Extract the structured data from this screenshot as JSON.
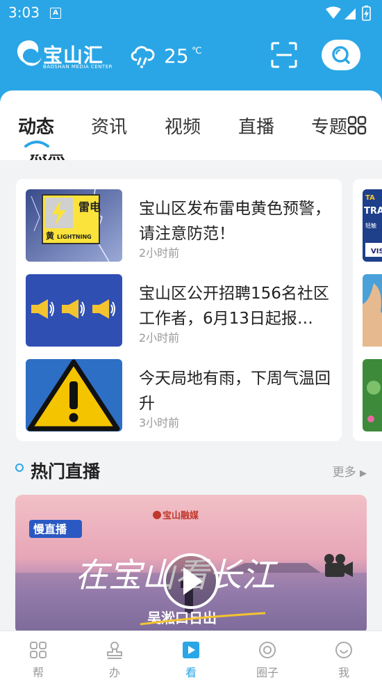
{
  "status_bar": {
    "time": "3:03",
    "notification_letter": "A"
  },
  "header": {
    "logo_text": "宝山汇",
    "logo_sub": "BAOSHAN MEDIA CENTER",
    "temperature": "25",
    "temperature_unit": "℃",
    "weather_icon": "rain-cloud-icon",
    "accent_color": "#2aa6e6"
  },
  "tabs": [
    {
      "label": "动态",
      "active": true
    },
    {
      "label": "资讯",
      "active": false
    },
    {
      "label": "视频",
      "active": false
    },
    {
      "label": "直播",
      "active": false
    },
    {
      "label": "专题",
      "active": false
    }
  ],
  "news": [
    {
      "title": "宝山区发布雷电黄色预警，请注意防范！",
      "time": "2小时前",
      "thumb": "lightning-warning-image",
      "thumb_text": {
        "top": "雷电",
        "left": "黄",
        "badge": "LIGHTNING"
      }
    },
    {
      "title": "宝山区公开招聘156名社区工作者，6月13日起报…",
      "time": "2小时前",
      "thumb": "megaphones-image"
    },
    {
      "title": "今天局地有雨，下周气温回升",
      "time": "3小时前",
      "thumb": "warning-sign-image"
    }
  ],
  "peek_card": {
    "thumb_text": [
      "TA",
      "TRA",
      "轻触",
      "VIS"
    ]
  },
  "hot_live": {
    "title": "热门直播",
    "more": "更多",
    "live_title": "在宝山看长江",
    "live_subtitle": "吴淞口日出",
    "live_brand": "宝山融媒",
    "live_badge": "慢直播"
  },
  "bottom_nav": [
    {
      "label": "帮",
      "icon": "grid-icon",
      "active": false
    },
    {
      "label": "办",
      "icon": "stamp-icon",
      "active": false
    },
    {
      "label": "看",
      "icon": "play-icon",
      "active": true
    },
    {
      "label": "圈子",
      "icon": "circle-icon",
      "active": false
    },
    {
      "label": "我",
      "icon": "smile-icon",
      "active": false
    }
  ]
}
